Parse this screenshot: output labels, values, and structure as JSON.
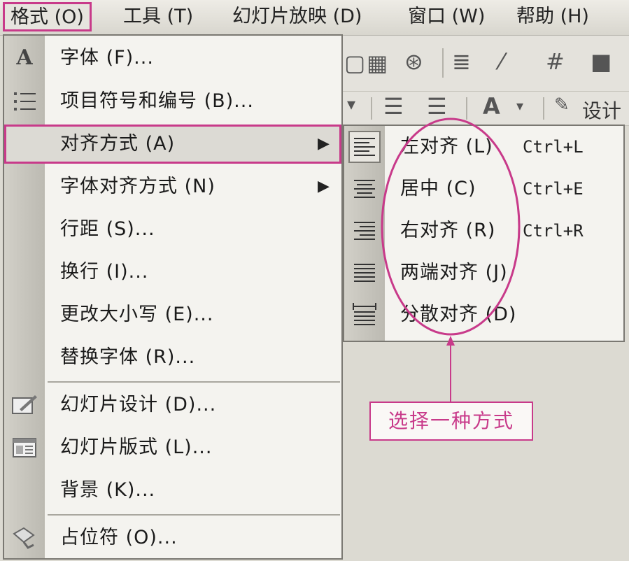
{
  "menubar": {
    "items": [
      {
        "label": "格式 (O)",
        "active": true
      },
      {
        "label": "工具 (T)"
      },
      {
        "label": "幻灯片放映 (D)"
      },
      {
        "label": "窗口 (W)"
      },
      {
        "label": "帮助 (H)"
      }
    ]
  },
  "toolbar": {
    "design_label": "设计"
  },
  "format_menu": {
    "items": [
      {
        "label": "字体 (F)...",
        "icon": "font-a-icon"
      },
      {
        "label": "项目符号和编号 (B)...",
        "icon": "bullets-icon"
      },
      {
        "label": "对齐方式 (A)",
        "submenu": true,
        "highlighted": true
      },
      {
        "label": "字体对齐方式 (N)",
        "submenu": true
      },
      {
        "label": "行距 (S)..."
      },
      {
        "label": "换行 (I)..."
      },
      {
        "label": "更改大小写 (E)..."
      },
      {
        "label": "替换字体 (R)..."
      },
      {
        "label": "幻灯片设计 (D)...",
        "icon": "slide-design-icon"
      },
      {
        "label": "幻灯片版式 (L)...",
        "icon": "slide-layout-icon"
      },
      {
        "label": "背景 (K)..."
      },
      {
        "label": "占位符 (O)...",
        "icon": "placeholder-icon"
      }
    ]
  },
  "align_submenu": {
    "items": [
      {
        "label": "左对齐 (L)",
        "shortcut": "Ctrl+L",
        "icon": "align-left-icon",
        "checked": true
      },
      {
        "label": "居中 (C)",
        "shortcut": "Ctrl+E",
        "icon": "align-center-icon"
      },
      {
        "label": "右对齐 (R)",
        "shortcut": "Ctrl+R",
        "icon": "align-right-icon"
      },
      {
        "label": "两端对齐 (J)",
        "shortcut": "",
        "icon": "align-justify-icon"
      },
      {
        "label": "分散对齐 (D)",
        "shortcut": "",
        "icon": "align-distributed-icon"
      }
    ]
  },
  "annotation": {
    "text": "选择一种方式"
  },
  "colors": {
    "highlight": "#c83a8a",
    "menu_bg": "#f4f3ef",
    "gutter": "#c8c6be"
  }
}
